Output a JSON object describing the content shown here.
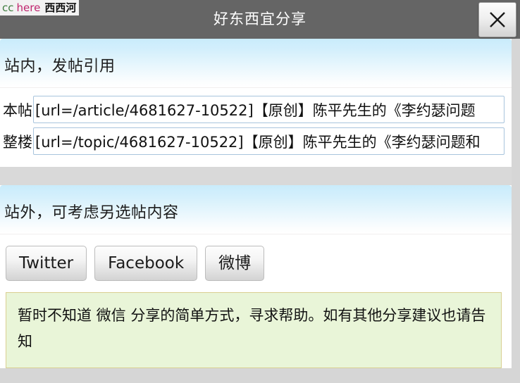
{
  "logo": {
    "part_cc": "cc",
    "part_here": "here",
    "part_cn": "西西河",
    "color_cc": "#3f7d3f",
    "color_here": "#c0246e",
    "color_cn": "#111111"
  },
  "titlebar": {
    "title": "好东西宜分享",
    "background": "#656565",
    "title_color": "#ffffff",
    "close_icon": "close-icon",
    "close_label": "×"
  },
  "sections": {
    "in_site": {
      "heading": "站内，发帖引用",
      "heading_gradient_top": "#c9ecfb",
      "fields": [
        {
          "label": "本帖",
          "value": "[url=/article/4681627-10522]【原创】陈平先生的《李约瑟问题",
          "placeholder": ""
        },
        {
          "label": "整楼",
          "value": "[url=/topic/4681627-10522]【原创】陈平先生的《李约瑟问题和",
          "placeholder": ""
        }
      ]
    },
    "off_site": {
      "heading": "站外，可考虑另选帖内容",
      "buttons": [
        {
          "label": "Twitter",
          "name": "share-twitter-button"
        },
        {
          "label": "Facebook",
          "name": "share-facebook-button"
        },
        {
          "label": "微博",
          "name": "share-weibo-button"
        }
      ],
      "notice": "暂时不知道 微信 分享的简单方式，寻求帮助。如有其他分享建议也请告知",
      "notice_bg": "#e9f5d8",
      "notice_border": "#d9cf91"
    }
  }
}
